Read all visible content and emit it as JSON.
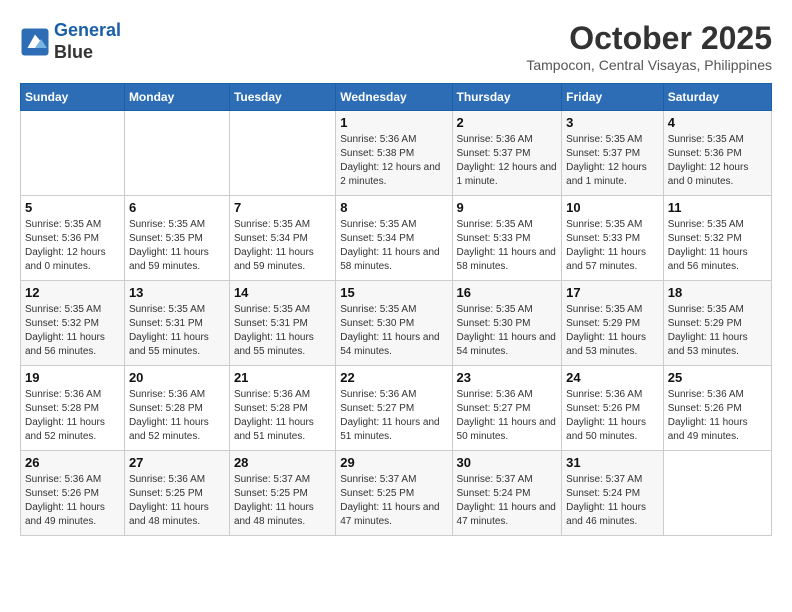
{
  "header": {
    "logo_line1": "General",
    "logo_line2": "Blue",
    "month": "October 2025",
    "location": "Tampocon, Central Visayas, Philippines"
  },
  "weekdays": [
    "Sunday",
    "Monday",
    "Tuesday",
    "Wednesday",
    "Thursday",
    "Friday",
    "Saturday"
  ],
  "weeks": [
    [
      {
        "day": "",
        "sunrise": "",
        "sunset": "",
        "daylight": ""
      },
      {
        "day": "",
        "sunrise": "",
        "sunset": "",
        "daylight": ""
      },
      {
        "day": "",
        "sunrise": "",
        "sunset": "",
        "daylight": ""
      },
      {
        "day": "1",
        "sunrise": "Sunrise: 5:36 AM",
        "sunset": "Sunset: 5:38 PM",
        "daylight": "Daylight: 12 hours and 2 minutes."
      },
      {
        "day": "2",
        "sunrise": "Sunrise: 5:36 AM",
        "sunset": "Sunset: 5:37 PM",
        "daylight": "Daylight: 12 hours and 1 minute."
      },
      {
        "day": "3",
        "sunrise": "Sunrise: 5:35 AM",
        "sunset": "Sunset: 5:37 PM",
        "daylight": "Daylight: 12 hours and 1 minute."
      },
      {
        "day": "4",
        "sunrise": "Sunrise: 5:35 AM",
        "sunset": "Sunset: 5:36 PM",
        "daylight": "Daylight: 12 hours and 0 minutes."
      }
    ],
    [
      {
        "day": "5",
        "sunrise": "Sunrise: 5:35 AM",
        "sunset": "Sunset: 5:36 PM",
        "daylight": "Daylight: 12 hours and 0 minutes."
      },
      {
        "day": "6",
        "sunrise": "Sunrise: 5:35 AM",
        "sunset": "Sunset: 5:35 PM",
        "daylight": "Daylight: 11 hours and 59 minutes."
      },
      {
        "day": "7",
        "sunrise": "Sunrise: 5:35 AM",
        "sunset": "Sunset: 5:34 PM",
        "daylight": "Daylight: 11 hours and 59 minutes."
      },
      {
        "day": "8",
        "sunrise": "Sunrise: 5:35 AM",
        "sunset": "Sunset: 5:34 PM",
        "daylight": "Daylight: 11 hours and 58 minutes."
      },
      {
        "day": "9",
        "sunrise": "Sunrise: 5:35 AM",
        "sunset": "Sunset: 5:33 PM",
        "daylight": "Daylight: 11 hours and 58 minutes."
      },
      {
        "day": "10",
        "sunrise": "Sunrise: 5:35 AM",
        "sunset": "Sunset: 5:33 PM",
        "daylight": "Daylight: 11 hours and 57 minutes."
      },
      {
        "day": "11",
        "sunrise": "Sunrise: 5:35 AM",
        "sunset": "Sunset: 5:32 PM",
        "daylight": "Daylight: 11 hours and 56 minutes."
      }
    ],
    [
      {
        "day": "12",
        "sunrise": "Sunrise: 5:35 AM",
        "sunset": "Sunset: 5:32 PM",
        "daylight": "Daylight: 11 hours and 56 minutes."
      },
      {
        "day": "13",
        "sunrise": "Sunrise: 5:35 AM",
        "sunset": "Sunset: 5:31 PM",
        "daylight": "Daylight: 11 hours and 55 minutes."
      },
      {
        "day": "14",
        "sunrise": "Sunrise: 5:35 AM",
        "sunset": "Sunset: 5:31 PM",
        "daylight": "Daylight: 11 hours and 55 minutes."
      },
      {
        "day": "15",
        "sunrise": "Sunrise: 5:35 AM",
        "sunset": "Sunset: 5:30 PM",
        "daylight": "Daylight: 11 hours and 54 minutes."
      },
      {
        "day": "16",
        "sunrise": "Sunrise: 5:35 AM",
        "sunset": "Sunset: 5:30 PM",
        "daylight": "Daylight: 11 hours and 54 minutes."
      },
      {
        "day": "17",
        "sunrise": "Sunrise: 5:35 AM",
        "sunset": "Sunset: 5:29 PM",
        "daylight": "Daylight: 11 hours and 53 minutes."
      },
      {
        "day": "18",
        "sunrise": "Sunrise: 5:35 AM",
        "sunset": "Sunset: 5:29 PM",
        "daylight": "Daylight: 11 hours and 53 minutes."
      }
    ],
    [
      {
        "day": "19",
        "sunrise": "Sunrise: 5:36 AM",
        "sunset": "Sunset: 5:28 PM",
        "daylight": "Daylight: 11 hours and 52 minutes."
      },
      {
        "day": "20",
        "sunrise": "Sunrise: 5:36 AM",
        "sunset": "Sunset: 5:28 PM",
        "daylight": "Daylight: 11 hours and 52 minutes."
      },
      {
        "day": "21",
        "sunrise": "Sunrise: 5:36 AM",
        "sunset": "Sunset: 5:28 PM",
        "daylight": "Daylight: 11 hours and 51 minutes."
      },
      {
        "day": "22",
        "sunrise": "Sunrise: 5:36 AM",
        "sunset": "Sunset: 5:27 PM",
        "daylight": "Daylight: 11 hours and 51 minutes."
      },
      {
        "day": "23",
        "sunrise": "Sunrise: 5:36 AM",
        "sunset": "Sunset: 5:27 PM",
        "daylight": "Daylight: 11 hours and 50 minutes."
      },
      {
        "day": "24",
        "sunrise": "Sunrise: 5:36 AM",
        "sunset": "Sunset: 5:26 PM",
        "daylight": "Daylight: 11 hours and 50 minutes."
      },
      {
        "day": "25",
        "sunrise": "Sunrise: 5:36 AM",
        "sunset": "Sunset: 5:26 PM",
        "daylight": "Daylight: 11 hours and 49 minutes."
      }
    ],
    [
      {
        "day": "26",
        "sunrise": "Sunrise: 5:36 AM",
        "sunset": "Sunset: 5:26 PM",
        "daylight": "Daylight: 11 hours and 49 minutes."
      },
      {
        "day": "27",
        "sunrise": "Sunrise: 5:36 AM",
        "sunset": "Sunset: 5:25 PM",
        "daylight": "Daylight: 11 hours and 48 minutes."
      },
      {
        "day": "28",
        "sunrise": "Sunrise: 5:37 AM",
        "sunset": "Sunset: 5:25 PM",
        "daylight": "Daylight: 11 hours and 48 minutes."
      },
      {
        "day": "29",
        "sunrise": "Sunrise: 5:37 AM",
        "sunset": "Sunset: 5:25 PM",
        "daylight": "Daylight: 11 hours and 47 minutes."
      },
      {
        "day": "30",
        "sunrise": "Sunrise: 5:37 AM",
        "sunset": "Sunset: 5:24 PM",
        "daylight": "Daylight: 11 hours and 47 minutes."
      },
      {
        "day": "31",
        "sunrise": "Sunrise: 5:37 AM",
        "sunset": "Sunset: 5:24 PM",
        "daylight": "Daylight: 11 hours and 46 minutes."
      },
      {
        "day": "",
        "sunrise": "",
        "sunset": "",
        "daylight": ""
      }
    ]
  ]
}
